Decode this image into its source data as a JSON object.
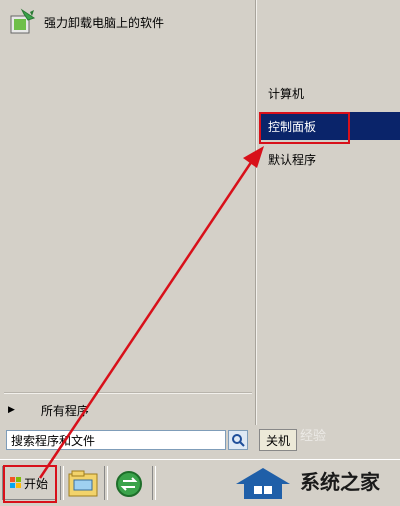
{
  "pinned_programs": [
    {
      "label": "强力卸载电脑上的软件",
      "icon": "uninstaller-icon"
    }
  ],
  "all_programs_label": "所有程序",
  "right_pane": {
    "items": [
      {
        "label": "计算机",
        "selected": false
      },
      {
        "label": "控制面板",
        "selected": true
      },
      {
        "label": "默认程序",
        "selected": false
      }
    ]
  },
  "search": {
    "placeholder": "搜索程序和文件",
    "icon": "search-icon"
  },
  "shutdown_label": "关机",
  "start_label": "开始",
  "taskbar_icons": [
    "explorer-icon",
    "ie-icon"
  ],
  "watermark": {
    "text": "系统之家",
    "faint_text": "经验"
  },
  "colors": {
    "annotation": "#d8101a",
    "selection": "#0a246a"
  }
}
